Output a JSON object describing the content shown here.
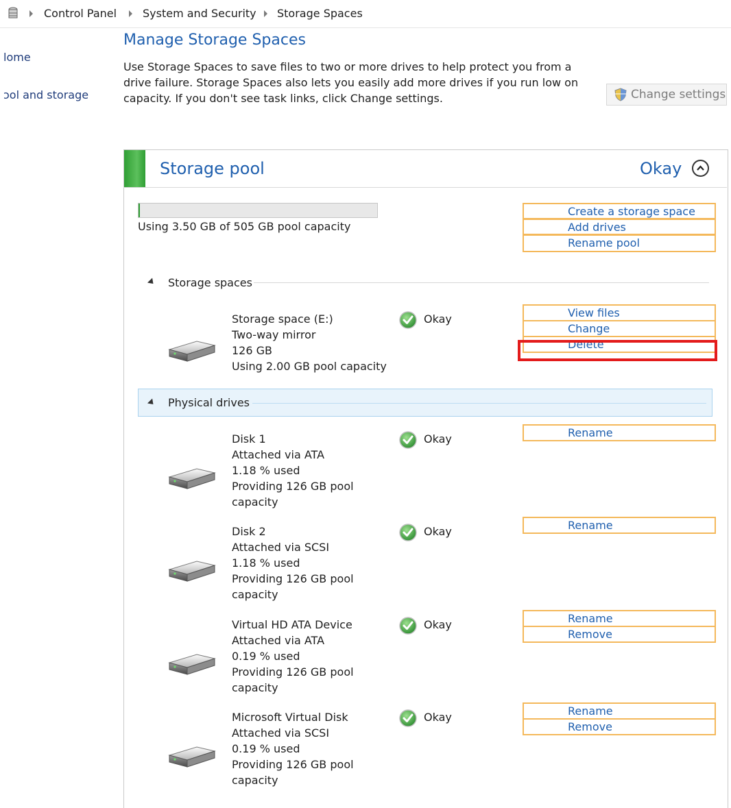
{
  "breadcrumb": {
    "items": [
      "Control Panel",
      "System and Security",
      "Storage Spaces"
    ]
  },
  "left_nav": {
    "home": "lome",
    "pool": "ɔol and storage"
  },
  "header": {
    "title": "Manage Storage Spaces",
    "description_lines": [
      "Use Storage Spaces to save files to two or more drives to help protect you from a",
      "drive failure. Storage Spaces also lets you easily add more drives if you run low on",
      "capacity. If you don't see task links, click Change settings."
    ],
    "change_settings": "Change settings"
  },
  "pool": {
    "title": "Storage pool",
    "status": "Okay",
    "capacity_text": "Using 3.50 GB of 505 GB pool capacity",
    "capacity_fraction": 0.0069,
    "actions": [
      "Create a storage space",
      "Add drives",
      "Rename pool"
    ]
  },
  "storage_spaces": {
    "header": "Storage spaces",
    "items": [
      {
        "lines": [
          "Storage space (E:)",
          "Two-way mirror",
          "126 GB",
          "Using 2.00 GB pool capacity"
        ],
        "status": "Okay",
        "actions": [
          "View files",
          "Change",
          "Delete"
        ]
      }
    ]
  },
  "physical_drives": {
    "header": "Physical drives",
    "items": [
      {
        "lines": [
          "Disk 1",
          "Attached via ATA",
          "1.18 % used",
          "Providing 126 GB pool",
          "capacity"
        ],
        "status": "Okay",
        "actions": [
          "Rename"
        ]
      },
      {
        "lines": [
          "Disk 2",
          "Attached via SCSI",
          "1.18 % used",
          "Providing 126 GB pool",
          "capacity"
        ],
        "status": "Okay",
        "actions": [
          "Rename"
        ]
      },
      {
        "lines": [
          "Virtual HD ATA Device",
          "Attached via ATA",
          "0.19 % used",
          "Providing 126 GB pool",
          "capacity"
        ],
        "status": "Okay",
        "actions": [
          "Rename",
          "Remove"
        ]
      },
      {
        "lines": [
          "Microsoft Virtual Disk",
          "Attached via SCSI",
          "0.19 % used",
          "Providing 126 GB pool",
          "capacity"
        ],
        "status": "Okay",
        "actions": [
          "Rename",
          "Remove"
        ]
      }
    ]
  },
  "colors": {
    "link": "#1f5fae",
    "ok_green": "#2f9e34",
    "action_border": "#f4b85a",
    "highlight": "#e31b1b"
  }
}
